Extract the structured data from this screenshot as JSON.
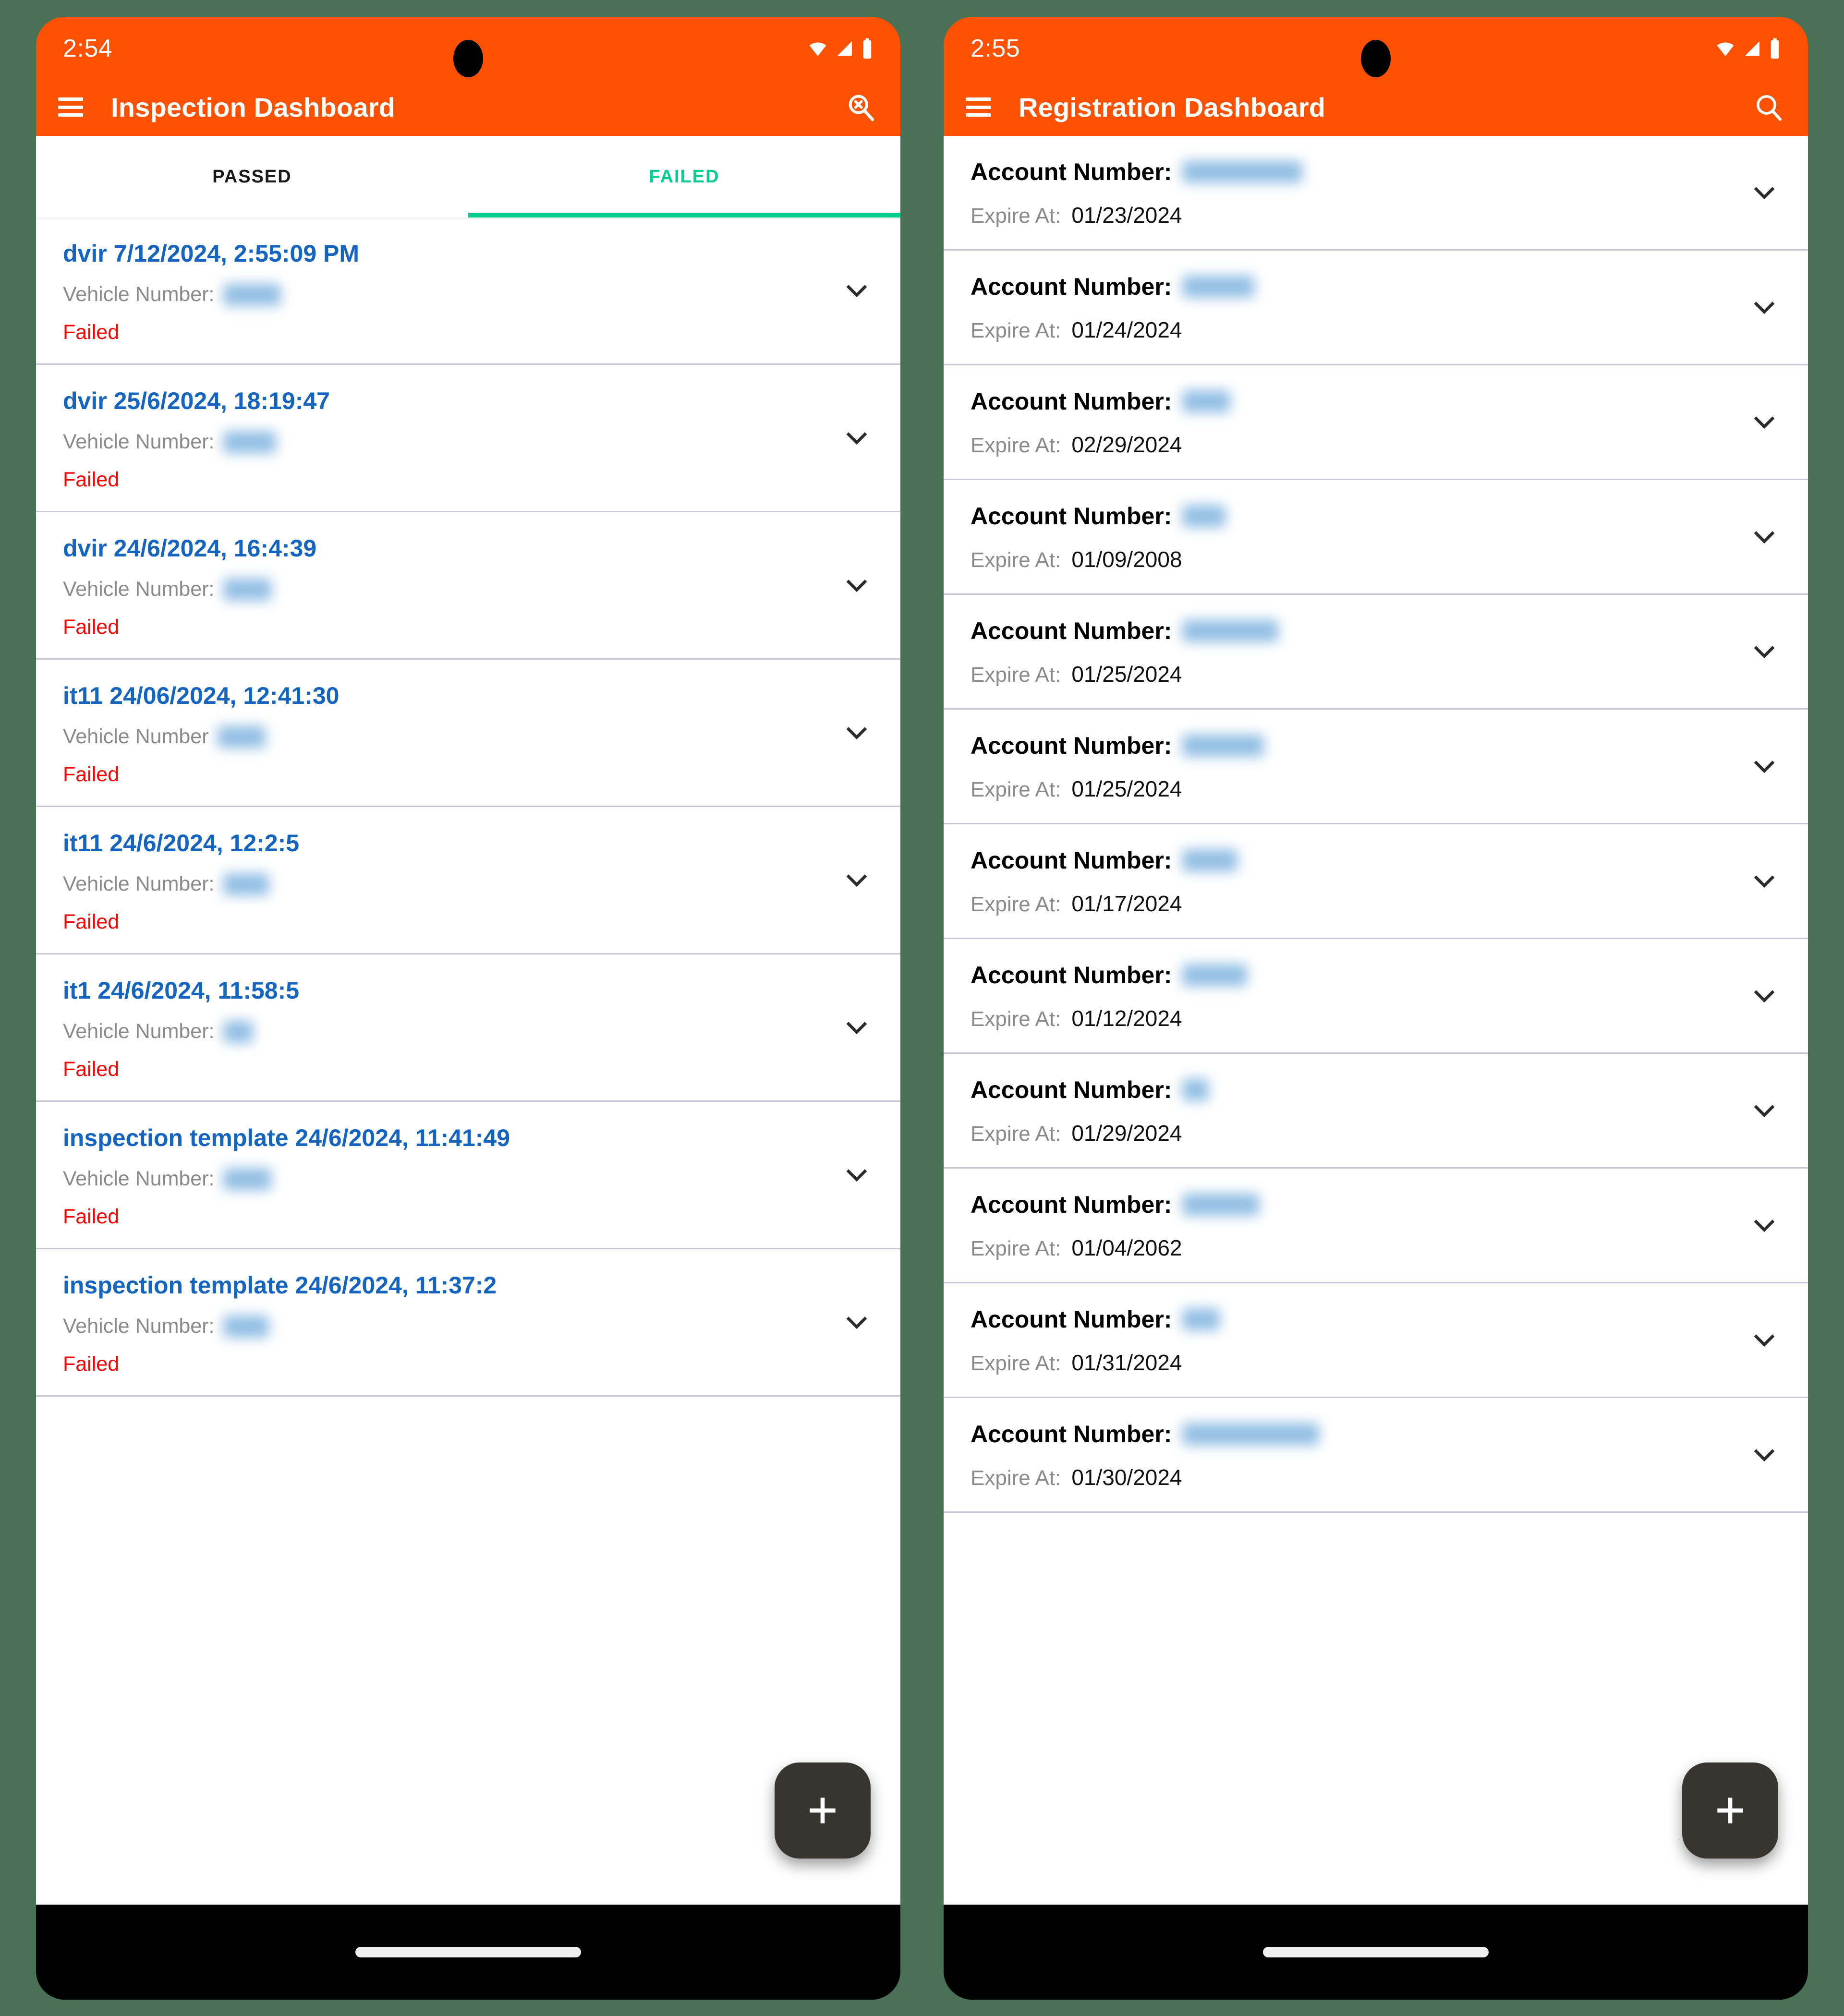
{
  "background_color": "#4a7055",
  "accent_color": "#fb5100",
  "tab_active_color": "#00ce91",
  "title_link_color": "#1565c0",
  "failed_color": "#ff0000",
  "phones": [
    {
      "id": "inspection",
      "status_bar": {
        "time": "2:54",
        "icons": [
          "wifi-icon",
          "cellular-signal-icon",
          "battery-icon"
        ]
      },
      "app_bar": {
        "menu_icon": "hamburger-menu-icon",
        "title": "Inspection Dashboard",
        "action_icon": "search-off-icon"
      },
      "tabs": [
        {
          "label": "PASSED",
          "active": false
        },
        {
          "label": "FAILED",
          "active": true
        }
      ],
      "list": [
        {
          "title": "dvir 7/12/2024, 2:55:09 PM",
          "sub_label": "Vehicle Number:",
          "redacted_width": 120,
          "status": "Failed"
        },
        {
          "title": "dvir 25/6/2024, 18:19:47",
          "sub_label": "Vehicle Number:",
          "redacted_width": 110,
          "status": "Failed"
        },
        {
          "title": "dvir 24/6/2024, 16:4:39",
          "sub_label": "Vehicle Number:",
          "redacted_width": 100,
          "status": "Failed"
        },
        {
          "title": "it11 24/06/2024, 12:41:30",
          "sub_label": "Vehicle Number",
          "redacted_width": 100,
          "status": "Failed"
        },
        {
          "title": "it11 24/6/2024, 12:2:5",
          "sub_label": "Vehicle Number:",
          "redacted_width": 95,
          "status": "Failed"
        },
        {
          "title": "it1 24/6/2024, 11:58:5",
          "sub_label": "Vehicle Number:",
          "redacted_width": 62,
          "status": "Failed"
        },
        {
          "title": "inspection template 24/6/2024, 11:41:49",
          "sub_label": "Vehicle Number:",
          "redacted_width": 100,
          "status": "Failed"
        },
        {
          "title": "inspection template 24/6/2024, 11:37:2",
          "sub_label": "Vehicle Number:",
          "redacted_width": 95,
          "status": "Failed"
        }
      ],
      "fab": {
        "icon": "plus-icon",
        "label": "+"
      }
    },
    {
      "id": "registration",
      "status_bar": {
        "time": "2:55",
        "icons": [
          "wifi-icon",
          "cellular-signal-icon",
          "battery-icon"
        ]
      },
      "app_bar": {
        "menu_icon": "hamburger-menu-icon",
        "title": "Registration Dashboard",
        "action_icon": "search-icon"
      },
      "list": [
        {
          "account_label": "Account Number:",
          "redacted_width": 250,
          "expire_label": "Expire At:",
          "expire_value": "01/23/2024",
          "partial_top": true
        },
        {
          "account_label": "Account Number:",
          "redacted_width": 150,
          "expire_label": "Expire At:",
          "expire_value": "01/24/2024"
        },
        {
          "account_label": "Account Number:",
          "redacted_width": 100,
          "expire_label": "Expire At:",
          "expire_value": "02/29/2024"
        },
        {
          "account_label": "Account Number:",
          "redacted_width": 90,
          "expire_label": "Expire At:",
          "expire_value": "01/09/2008"
        },
        {
          "account_label": "Account Number:",
          "redacted_width": 200,
          "expire_label": "Expire At:",
          "expire_value": "01/25/2024"
        },
        {
          "account_label": "Account Number:",
          "redacted_width": 170,
          "expire_label": "Expire At:",
          "expire_value": "01/25/2024"
        },
        {
          "account_label": "Account Number:",
          "redacted_width": 115,
          "expire_label": "Expire At:",
          "expire_value": "01/17/2024"
        },
        {
          "account_label": "Account Number:",
          "redacted_width": 135,
          "expire_label": "Expire At:",
          "expire_value": "01/12/2024"
        },
        {
          "account_label": "Account Number:",
          "redacted_width": 55,
          "expire_label": "Expire At:",
          "expire_value": "01/29/2024"
        },
        {
          "account_label": "Account Number:",
          "redacted_width": 160,
          "expire_label": "Expire At:",
          "expire_value": "01/04/2062"
        },
        {
          "account_label": "Account Number:",
          "redacted_width": 78,
          "expire_label": "Expire At:",
          "expire_value": "01/31/2024"
        },
        {
          "account_label": "Account Number:",
          "redacted_width": 285,
          "expire_label": "Expire At:",
          "expire_value": "01/30/2024"
        }
      ],
      "fab": {
        "icon": "plus-icon",
        "label": "+"
      }
    }
  ]
}
